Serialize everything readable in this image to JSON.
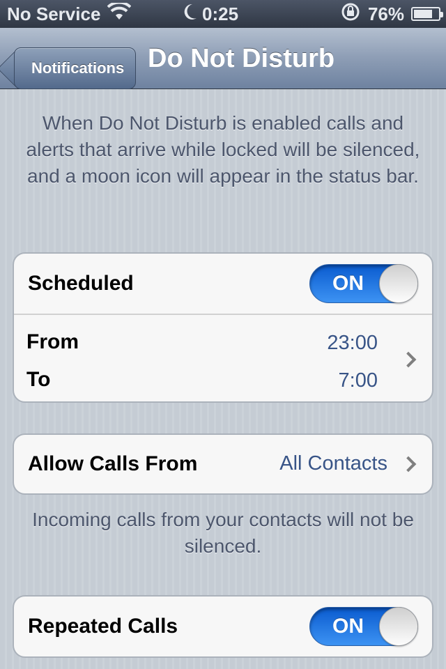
{
  "status_bar": {
    "carrier": "No Service",
    "time": "0:25",
    "battery": "76%",
    "battery_level": 0.76
  },
  "nav": {
    "back_label": "Notifications",
    "title": "Do Not Disturb"
  },
  "description": "When Do Not Disturb is enabled calls and alerts that arrive while locked will be silenced, and a moon icon will appear in the status bar.",
  "scheduled": {
    "label": "Scheduled",
    "toggle_label": "ON",
    "from_label": "From",
    "from_value": "23:00",
    "to_label": "To",
    "to_value": "7:00"
  },
  "allow_calls": {
    "label": "Allow Calls From",
    "value": "All Contacts",
    "footer": "Incoming calls from your contacts will not be silenced."
  },
  "repeated_calls": {
    "label": "Repeated Calls",
    "toggle_label": "ON"
  },
  "colors": {
    "toggle_on": "#1f7ae8",
    "value_text": "#385487",
    "background": "#c5ccd4"
  },
  "icons": {
    "wifi": "wifi-icon",
    "moon": "moon-icon",
    "rotation_lock": "rotation-lock-icon",
    "battery": "battery-icon",
    "chevron": "chevron-right-icon"
  }
}
